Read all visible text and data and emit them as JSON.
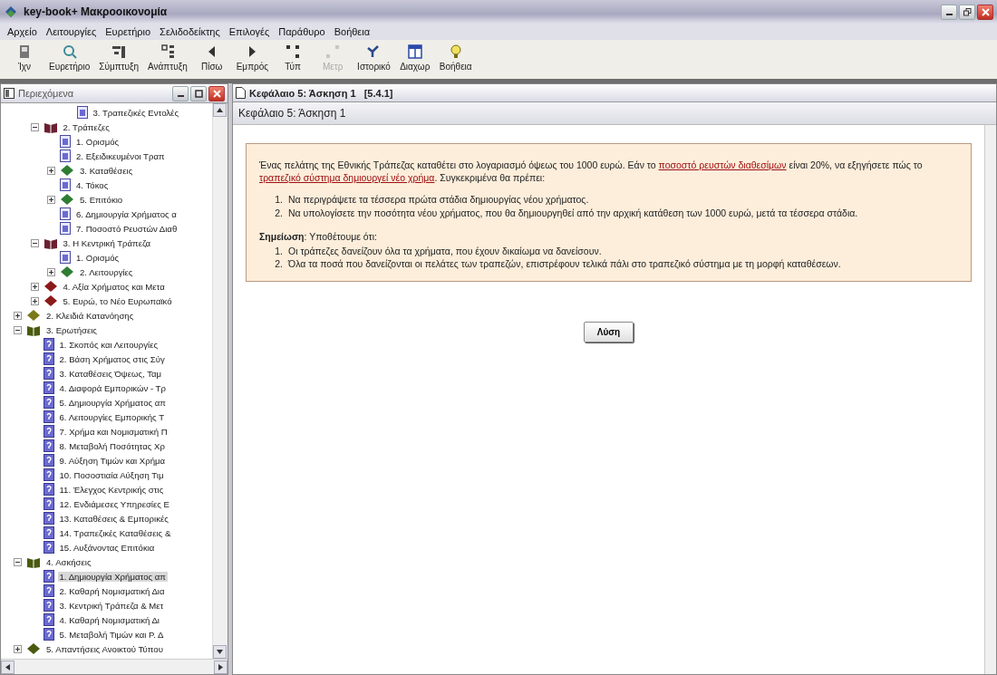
{
  "window": {
    "title": "key-book+  Μακροοικονομία"
  },
  "menu": [
    "Αρχείο",
    "Λειτουργίες",
    "Ευρετήριο",
    "Σελιδοδείκτης",
    "Επιλογές",
    "Παράθυρο",
    "Βοήθεια"
  ],
  "toolbar": [
    {
      "label": "Ίχν",
      "disabled": false
    },
    {
      "label": "Ευρετήριο",
      "disabled": false
    },
    {
      "label": "Σύμπτυξη",
      "disabled": false
    },
    {
      "label": "Ανάπτυξη",
      "disabled": false
    },
    {
      "label": "Πίσω",
      "disabled": false
    },
    {
      "label": "Εμπρός",
      "disabled": false
    },
    {
      "label": "Τύπ",
      "disabled": false
    },
    {
      "label": "Μετρ",
      "disabled": true
    },
    {
      "label": "Ιστορικό",
      "disabled": false
    },
    {
      "label": "Διαχωρ",
      "disabled": false
    },
    {
      "label": "Βοήθεια",
      "disabled": false
    }
  ],
  "contents_panel": {
    "title": "Περιεχόμενα",
    "tree": [
      {
        "children": [
          {
            "children": [
              {
                "children": [
                  {
                    "label": "3. Τραπεζικές Εντολές",
                    "kind": "page",
                    "selected": false
                  }
                ]
              }
            ]
          },
          {
            "label": "2. Τράπεζες",
            "kind": "open-book",
            "color": "#6b2030",
            "expanded": true,
            "selected": false,
            "children": [
              {
                "label": "1. Ορισμός",
                "kind": "page",
                "selected": false
              },
              {
                "label": "2. Εξειδικευμένοι Τραπ",
                "kind": "page",
                "selected": false
              },
              {
                "label": "3. Καταθέσεις",
                "kind": "book",
                "color": "#2e7d32",
                "expanded": false,
                "selected": false
              },
              {
                "label": "4. Τόκος",
                "kind": "page",
                "selected": false
              },
              {
                "label": "5. Επιτόκιο",
                "kind": "book",
                "color": "#2e7d32",
                "expanded": false,
                "selected": false
              },
              {
                "label": "6. Δημιουργία Χρήματος α",
                "kind": "page",
                "selected": false
              },
              {
                "label": "7. Ποσοστό Ρευστών Διαθ",
                "kind": "page",
                "selected": false
              }
            ]
          },
          {
            "label": "3. Η Κεντρική Τράπεζα",
            "kind": "open-book",
            "color": "#6b2030",
            "expanded": true,
            "selected": false,
            "children": [
              {
                "label": "1. Ορισμός",
                "kind": "page",
                "selected": false
              },
              {
                "label": "2. Λειτουργίες",
                "kind": "book",
                "color": "#2e7d32",
                "expanded": false,
                "selected": false
              }
            ]
          },
          {
            "label": "4. Αξία Χρήματος και Μετα",
            "kind": "book",
            "color": "#8b1a1a",
            "expanded": false,
            "selected": false
          },
          {
            "label": "5. Ευρώ, το Νέο Ευρωπαϊκό",
            "kind": "book",
            "color": "#8b1a1a",
            "expanded": false,
            "selected": false
          }
        ]
      },
      {
        "label": "2. Κλειδιά Κατανόησης",
        "kind": "book",
        "color": "#7a7a1a",
        "expanded": false,
        "selected": false
      },
      {
        "label": "3. Ερωτήσεις",
        "kind": "open-book",
        "color": "#4a5a10",
        "expanded": true,
        "selected": false,
        "children": [
          {
            "label": "1. Σκοπός και Λειτουργίες",
            "kind": "question",
            "selected": false
          },
          {
            "label": "2. Βάση Χρήματος στις Σύγ",
            "kind": "question",
            "selected": false
          },
          {
            "label": "3. Καταθέσεις Όψεως, Ταμ",
            "kind": "question",
            "selected": false
          },
          {
            "label": "4. Διαφορά Εμπορικών - Τρ",
            "kind": "question",
            "selected": false
          },
          {
            "label": "5. Δημιουργία Χρήματος απ",
            "kind": "question",
            "selected": false
          },
          {
            "label": "6. Λειτουργίες Εμπορικής Τ",
            "kind": "question",
            "selected": false
          },
          {
            "label": "7. Χρήμα και Νομισματική Π",
            "kind": "question",
            "selected": false
          },
          {
            "label": "8. Μεταβολή Ποσότητας Χρ",
            "kind": "question",
            "selected": false
          },
          {
            "label": "9. Αύξηση Τιμών και Χρήμα",
            "kind": "question",
            "selected": false
          },
          {
            "label": "10. Ποσοστιαία Αύξηση Τιμ",
            "kind": "question",
            "selected": false
          },
          {
            "label": "11. Έλεγχος Κεντρικής στις",
            "kind": "question",
            "selected": false
          },
          {
            "label": "12. Ενδιάμεσες Υπηρεσίες Ε",
            "kind": "question",
            "selected": false
          },
          {
            "label": "13. Καταθέσεις & Εμπορικές",
            "kind": "question",
            "selected": false
          },
          {
            "label": "14. Τραπεζικές Καταθέσεις &",
            "kind": "question",
            "selected": false
          },
          {
            "label": "15. Αυξάνοντας Επιτόκια",
            "kind": "question",
            "selected": false
          }
        ]
      },
      {
        "label": "4. Ασκήσεις",
        "kind": "open-book",
        "color": "#4a5a10",
        "expanded": true,
        "selected": false,
        "children": [
          {
            "label": "1. Δημιουργία Χρήματος απ",
            "kind": "question",
            "selected": true
          },
          {
            "label": "2. Καθαρή Νομισματική Δια",
            "kind": "question",
            "selected": false
          },
          {
            "label": "3. Κεντρική Τράπεζα & Μετ",
            "kind": "question",
            "selected": false
          },
          {
            "label": "4. Καθαρή Νομισματική Δι",
            "kind": "question",
            "selected": false
          },
          {
            "label": "5. Μεταβολή Τιμών και Ρ. Δ",
            "kind": "question",
            "selected": false
          }
        ]
      },
      {
        "label": "5. Απαντήσεις Ανοικτού Τύπου",
        "kind": "book",
        "color": "#4a5a10",
        "expanded": false,
        "selected": false
      }
    ]
  },
  "document_panel": {
    "title": "Κεφάλαιο 5: Άσκηση 1   [5.4.1]",
    "heading": "Κεφάλαιο 5: Άσκηση 1",
    "intro": [
      {
        "kind": "text",
        "text": "Ένας πελάτης της Εθνικής Τράπεζας καταθέτει στο λογαριασμό όψεως του 1000 ευρώ. Εάν το "
      },
      {
        "kind": "link",
        "text": "ποσοστό ρευστών διαθεσίμων"
      },
      {
        "kind": "text",
        "text": " είναι 20%, να εξηγήσετε πώς το "
      },
      {
        "kind": "link",
        "text": "τραπεζικό σύστημα δημιουργεί νέο χρήμα"
      },
      {
        "kind": "text",
        "text": ". Συγκεκριμένα θα πρέπει:"
      }
    ],
    "tasks": [
      {
        "marker": "1.",
        "text": "Να περιγράψετε τα τέσσερα πρώτα στάδια δημιουργίας νέου χρήματος."
      },
      {
        "marker": "2.",
        "text": "Να υπολογίσετε την ποσότητα νέου χρήματος, που θα δημιουργηθεί από την αρχική κατάθεση των 1000 ευρώ, μετά τα τέσσερα στάδια."
      }
    ],
    "note": "**Σημείωση**: Υποθέτουμε ότι:",
    "assumptions": [
      {
        "marker": "1.",
        "text": "Οι τράπεζες δανείζουν όλα τα χρήματα, που έχουν δικαίωμα να δανείσουν."
      },
      {
        "marker": "2.",
        "text": "Όλα τα ποσά που δανείζονται οι πελάτες των τραπεζών, επιστρέφουν τελικά πάλι στο τραπεζικό σύστημα με τη μορφή καταθέσεων."
      }
    ],
    "button": "Λύση"
  }
}
